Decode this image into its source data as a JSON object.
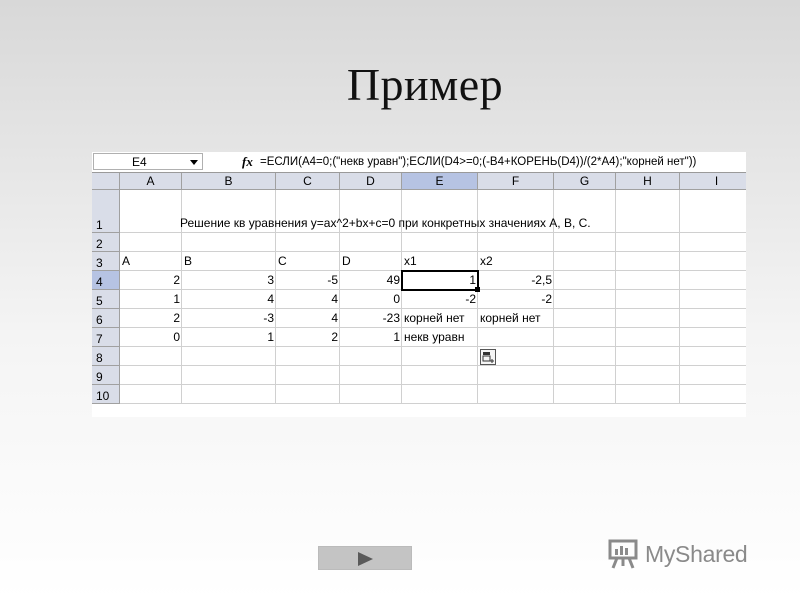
{
  "slide": {
    "title": "Пример"
  },
  "spreadsheet": {
    "name_box": "E4",
    "fx_label": "fx",
    "formula": "=ЕСЛИ(A4=0;(\"некв уравн\");ЕСЛИ(D4>=0;(-B4+КОРЕНЬ(D4))/(2*A4);\"корней нет\"))",
    "columns": [
      "A",
      "B",
      "C",
      "D",
      "E",
      "F",
      "G",
      "H",
      "I"
    ],
    "selected_column": "E",
    "selected_row": "4",
    "rows": [
      {
        "num": "1",
        "cells": [
          {
            "col": "A",
            "value": "Решение кв уравнения y=ax^2+bx+c=0 при конкретных значениях A, B, C.",
            "align": "l",
            "offset": 58
          }
        ]
      },
      {
        "num": "2",
        "cells": []
      },
      {
        "num": "3",
        "cells": [
          {
            "col": "A",
            "value": "A",
            "align": "l"
          },
          {
            "col": "B",
            "value": "B",
            "align": "l"
          },
          {
            "col": "C",
            "value": "C",
            "align": "l"
          },
          {
            "col": "D",
            "value": "D",
            "align": "l"
          },
          {
            "col": "E",
            "value": "x1",
            "align": "l"
          },
          {
            "col": "F",
            "value": "x2",
            "align": "l"
          }
        ]
      },
      {
        "num": "4",
        "cells": [
          {
            "col": "A",
            "value": "2",
            "align": "r"
          },
          {
            "col": "B",
            "value": "3",
            "align": "r"
          },
          {
            "col": "C",
            "value": "-5",
            "align": "r"
          },
          {
            "col": "D",
            "value": "49",
            "align": "r"
          },
          {
            "col": "E",
            "value": "1",
            "align": "r"
          },
          {
            "col": "F",
            "value": "-2,5",
            "align": "r"
          }
        ]
      },
      {
        "num": "5",
        "cells": [
          {
            "col": "A",
            "value": "1",
            "align": "r"
          },
          {
            "col": "B",
            "value": "4",
            "align": "r"
          },
          {
            "col": "C",
            "value": "4",
            "align": "r"
          },
          {
            "col": "D",
            "value": "0",
            "align": "r"
          },
          {
            "col": "E",
            "value": "-2",
            "align": "r"
          },
          {
            "col": "F",
            "value": "-2",
            "align": "r"
          }
        ]
      },
      {
        "num": "6",
        "cells": [
          {
            "col": "A",
            "value": "2",
            "align": "r"
          },
          {
            "col": "B",
            "value": "-3",
            "align": "r"
          },
          {
            "col": "C",
            "value": "4",
            "align": "r"
          },
          {
            "col": "D",
            "value": "-23",
            "align": "r"
          },
          {
            "col": "E",
            "value": "корней нет",
            "align": "l"
          },
          {
            "col": "F",
            "value": "корней нет",
            "align": "l"
          }
        ]
      },
      {
        "num": "7",
        "cells": [
          {
            "col": "A",
            "value": "0",
            "align": "r"
          },
          {
            "col": "B",
            "value": "1",
            "align": "r"
          },
          {
            "col": "C",
            "value": "2",
            "align": "r"
          },
          {
            "col": "D",
            "value": "1",
            "align": "r"
          },
          {
            "col": "E",
            "value": "некв уравн",
            "align": "l"
          }
        ]
      },
      {
        "num": "8",
        "cells": []
      },
      {
        "num": "9",
        "cells": []
      },
      {
        "num": "10",
        "cells": []
      }
    ]
  },
  "navigation": {
    "next_icon": "play-arrow-icon"
  },
  "logo": {
    "text": "MyShared",
    "icon": "presentation-board-icon",
    "color": "#8a8a8a"
  }
}
